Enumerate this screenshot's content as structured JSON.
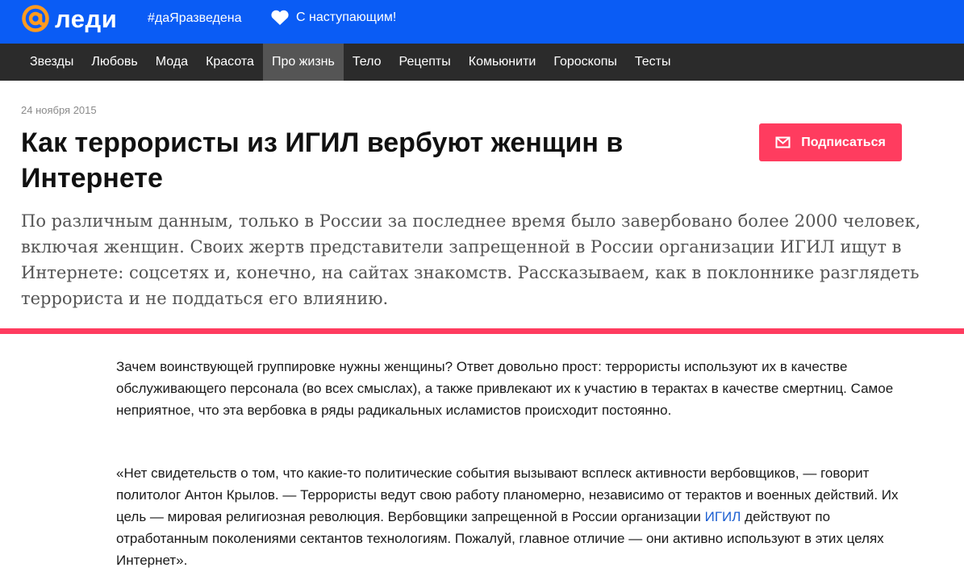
{
  "header": {
    "logo_text": "леди",
    "logo_icon": "at-sign-icon",
    "hashtag": "#даЯразведена",
    "promo_icon": "heart-icon",
    "promo_text": "С наступающим!"
  },
  "nav": {
    "items": [
      "Звезды",
      "Любовь",
      "Мода",
      "Красота",
      "Про жизнь",
      "Тело",
      "Рецепты",
      "Комьюнити",
      "Гороскопы",
      "Тесты"
    ],
    "active": "Про жизнь"
  },
  "article": {
    "date": "24 ноября 2015",
    "title": "Как террористы из ИГИЛ вербуют женщин в Интернете",
    "subscribe_label": "Подписаться",
    "subscribe_icon": "envelope-icon",
    "lead": "По различным данным, только в России за последнее время было завербовано более 2000 человек, включая женщин. Своих жертв представители запрещенной в России организации ИГИЛ ищут в Интернете: соцсетях и, конечно, на сайтах знакомств. Рассказываем, как в поклоннике разглядеть террориста и не поддаться его влиянию.",
    "paragraph1": "Зачем воинствующей группировке нужны женщины? Ответ довольно прост: террористы используют их в качестве обслуживающего персонала (во всех смыслах), а также привлекают их к участию в терактах в качестве смертниц. Самое неприятное, что эта вербовка в ряды радикальных исламистов происходит постоянно.",
    "paragraph2_before": "«Нет свидетельств о том, что какие-то политические события вызывают всплеск активности вербовщиков, — говорит политолог Антон Крылов. — Террористы ведут свою работу планомерно, независимо от терактов и военных действий. Их цель — мировая религиозная революция. Вербовщики запрещенной в России организации ",
    "paragraph2_link": "ИГИЛ",
    "paragraph2_after": " действуют по отработанным поколениями сектантов технологиям. Пожалуй, главное отличие — они активно используют в этих целях Интернет»."
  },
  "colors": {
    "brand_blue": "#0a5cf5",
    "nav_bg": "#2b2b2b",
    "nav_active": "#555555",
    "accent_pink": "#ff3c5f",
    "link_blue": "#1c5fd1"
  }
}
